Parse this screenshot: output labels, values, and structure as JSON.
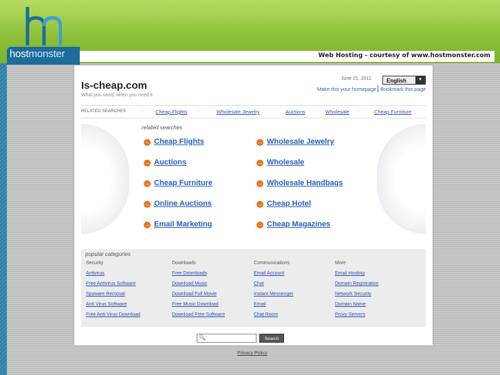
{
  "brand": {
    "logo_host": "host",
    "logo_monster": "monster",
    "banner": "Web Hosting - courtesy of www.hostmonster.com"
  },
  "site": {
    "title": "Is-cheap.com",
    "tagline": "What you need, when you need it"
  },
  "header": {
    "date": "June 21, 2011",
    "language": "English",
    "make_homepage": "Make this your homepage",
    "bookmark": "Bookmark this page"
  },
  "related_bar": {
    "label": "RELATED SEARCHES",
    "links": [
      "Cheap Flights",
      "Wholesale Jewelry",
      "Auctions",
      "Wholesale",
      "Cheap Furniture"
    ]
  },
  "related": {
    "subtitle": "related searches",
    "left": [
      "Cheap Flights",
      "Auctions",
      "Cheap Furniture",
      "Online Auctions",
      "Email Marketing"
    ],
    "right": [
      "Wholesale Jewelry",
      "Wholesale",
      "Wholesale Handbags",
      "Cheap Hotel",
      "Cheap Magazines"
    ]
  },
  "popular": {
    "title": "popular categories",
    "columns": [
      {
        "head": "Security",
        "links": [
          "Antivirus",
          "Free Antivirus Software",
          "Spyware Removal",
          "Anti Virus Software",
          "Free Anti Virus Download"
        ]
      },
      {
        "head": "Downloads",
        "links": [
          "Free Downloads",
          "Download Music",
          "Download Full Movie",
          "Free Music Download",
          "Download Free Software"
        ]
      },
      {
        "head": "Communications",
        "links": [
          "Email Account",
          "Chat",
          "Instant Messenger",
          "Email",
          "Chat Room"
        ]
      },
      {
        "head": "More",
        "links": [
          "Email Hosting",
          "Domain Registration",
          "Network Security",
          "Domain Name",
          "Proxy Servers"
        ]
      }
    ]
  },
  "search": {
    "placeholder": "",
    "button": "Search"
  },
  "footer": {
    "privacy": "Privacy Policy"
  },
  "colors": {
    "accent_green": "#8fc23a",
    "brand_blue": "#1e6c9a",
    "link_blue": "#2a5fbb",
    "bullet_orange": "#e8751a"
  }
}
